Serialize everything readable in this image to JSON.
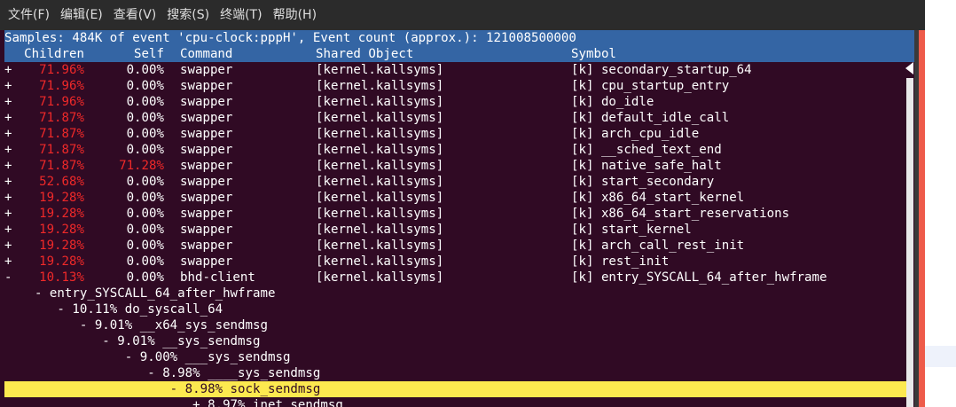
{
  "menu": [
    "文件(F)",
    "编辑(E)",
    "查看(V)",
    "搜索(S)",
    "终端(T)",
    "帮助(H)"
  ],
  "header": {
    "samples": "Samples: 484K of event 'cpu-clock:pppH', Event count (approx.): 121008500000",
    "columns": {
      "children": "Children",
      "self": "Self",
      "command": "Command",
      "shared_object": "Shared Object",
      "symbol": "Symbol"
    }
  },
  "rows": [
    {
      "sign": "+",
      "children": "71.96%",
      "self": "0.00%",
      "command": "swapper",
      "object": "[kernel.kallsyms]",
      "symbol": "[k] secondary_startup_64",
      "children_red": true,
      "self_red": false
    },
    {
      "sign": "+",
      "children": "71.96%",
      "self": "0.00%",
      "command": "swapper",
      "object": "[kernel.kallsyms]",
      "symbol": "[k] cpu_startup_entry",
      "children_red": true,
      "self_red": false
    },
    {
      "sign": "+",
      "children": "71.96%",
      "self": "0.00%",
      "command": "swapper",
      "object": "[kernel.kallsyms]",
      "symbol": "[k] do_idle",
      "children_red": true,
      "self_red": false
    },
    {
      "sign": "+",
      "children": "71.87%",
      "self": "0.00%",
      "command": "swapper",
      "object": "[kernel.kallsyms]",
      "symbol": "[k] default_idle_call",
      "children_red": true,
      "self_red": false
    },
    {
      "sign": "+",
      "children": "71.87%",
      "self": "0.00%",
      "command": "swapper",
      "object": "[kernel.kallsyms]",
      "symbol": "[k] arch_cpu_idle",
      "children_red": true,
      "self_red": false
    },
    {
      "sign": "+",
      "children": "71.87%",
      "self": "0.00%",
      "command": "swapper",
      "object": "[kernel.kallsyms]",
      "symbol": "[k] __sched_text_end",
      "children_red": true,
      "self_red": false
    },
    {
      "sign": "+",
      "children": "71.87%",
      "self": "71.28%",
      "command": "swapper",
      "object": "[kernel.kallsyms]",
      "symbol": "[k] native_safe_halt",
      "children_red": true,
      "self_red": true
    },
    {
      "sign": "+",
      "children": "52.68%",
      "self": "0.00%",
      "command": "swapper",
      "object": "[kernel.kallsyms]",
      "symbol": "[k] start_secondary",
      "children_red": true,
      "self_red": false
    },
    {
      "sign": "+",
      "children": "19.28%",
      "self": "0.00%",
      "command": "swapper",
      "object": "[kernel.kallsyms]",
      "symbol": "[k] x86_64_start_kernel",
      "children_red": true,
      "self_red": false
    },
    {
      "sign": "+",
      "children": "19.28%",
      "self": "0.00%",
      "command": "swapper",
      "object": "[kernel.kallsyms]",
      "symbol": "[k] x86_64_start_reservations",
      "children_red": true,
      "self_red": false
    },
    {
      "sign": "+",
      "children": "19.28%",
      "self": "0.00%",
      "command": "swapper",
      "object": "[kernel.kallsyms]",
      "symbol": "[k] start_kernel",
      "children_red": true,
      "self_red": false
    },
    {
      "sign": "+",
      "children": "19.28%",
      "self": "0.00%",
      "command": "swapper",
      "object": "[kernel.kallsyms]",
      "symbol": "[k] arch_call_rest_init",
      "children_red": true,
      "self_red": false
    },
    {
      "sign": "+",
      "children": "19.28%",
      "self": "0.00%",
      "command": "swapper",
      "object": "[kernel.kallsyms]",
      "symbol": "[k] rest_init",
      "children_red": true,
      "self_red": false
    },
    {
      "sign": "-",
      "children": "10.13%",
      "self": "0.00%",
      "command": "bhd-client",
      "object": "[kernel.kallsyms]",
      "symbol": "[k] entry_SYSCALL_64_after_hwframe",
      "children_red": true,
      "self_red": false
    }
  ],
  "tree": [
    "    - entry_SYSCALL_64_after_hwframe",
    "       - 10.11% do_syscall_64",
    "          - 9.01% __x64_sys_sendmsg",
    "             - 9.01% __sys_sendmsg",
    "                - 9.00% ___sys_sendmsg",
    "                   - 8.98% ____sys_sendmsg",
    "                      - 8.98% sock_sendmsg",
    "                         + 8.97% inet_sendmsg"
  ],
  "highlight_index": 6,
  "colors": {
    "terminal_bg": "#300a24",
    "header_bg": "#3465a4",
    "red": "#ef2929",
    "highlight": "#fce94f"
  }
}
